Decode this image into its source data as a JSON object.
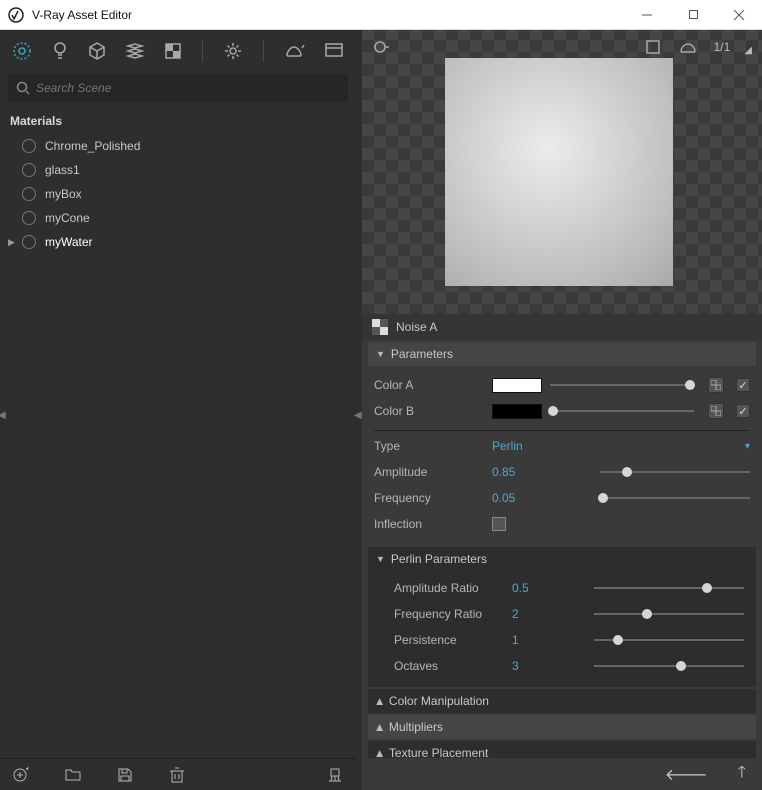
{
  "window": {
    "title": "V-Ray Asset Editor"
  },
  "search": {
    "placeholder": "Search Scene"
  },
  "materials": {
    "heading": "Materials",
    "items": [
      {
        "label": "Chrome_Polished",
        "selected": false,
        "caret": false
      },
      {
        "label": "glass1",
        "selected": false,
        "caret": false
      },
      {
        "label": "myBox",
        "selected": false,
        "caret": false
      },
      {
        "label": "myCone",
        "selected": false,
        "caret": false
      },
      {
        "label": "myWater",
        "selected": true,
        "caret": true
      }
    ]
  },
  "preview": {
    "count_label": "1/1"
  },
  "node": {
    "title": "Noise A"
  },
  "sections": {
    "parameters_label": "Parameters",
    "perlin_label": "Perlin Parameters",
    "color_manip_label": "Color Manipulation",
    "multipliers_label": "Multipliers",
    "tex_place_label": "Texture Placement"
  },
  "params": {
    "color_a": {
      "label": "Color A",
      "hex": "#ffffff",
      "slider": 0.97,
      "enabled": true
    },
    "color_b": {
      "label": "Color B",
      "hex": "#000000",
      "slider": 0.02,
      "enabled": true
    },
    "type": {
      "label": "Type",
      "value": "Perlin"
    },
    "amplitude": {
      "label": "Amplitude",
      "value": "0.85",
      "slider": 0.18
    },
    "frequency": {
      "label": "Frequency",
      "value": "0.05",
      "slider": 0.02
    },
    "inflection": {
      "label": "Inflection",
      "checked": false
    }
  },
  "perlin": {
    "amp_ratio": {
      "label": "Amplitude Ratio",
      "value": "0.5",
      "slider": 0.75
    },
    "freq_ratio": {
      "label": "Frequency Ratio",
      "value": "2",
      "slider": 0.35
    },
    "persist": {
      "label": "Persistence",
      "value": "1",
      "slider": 0.16
    },
    "octaves": {
      "label": "Octaves",
      "value": "3",
      "slider": 0.58
    }
  }
}
